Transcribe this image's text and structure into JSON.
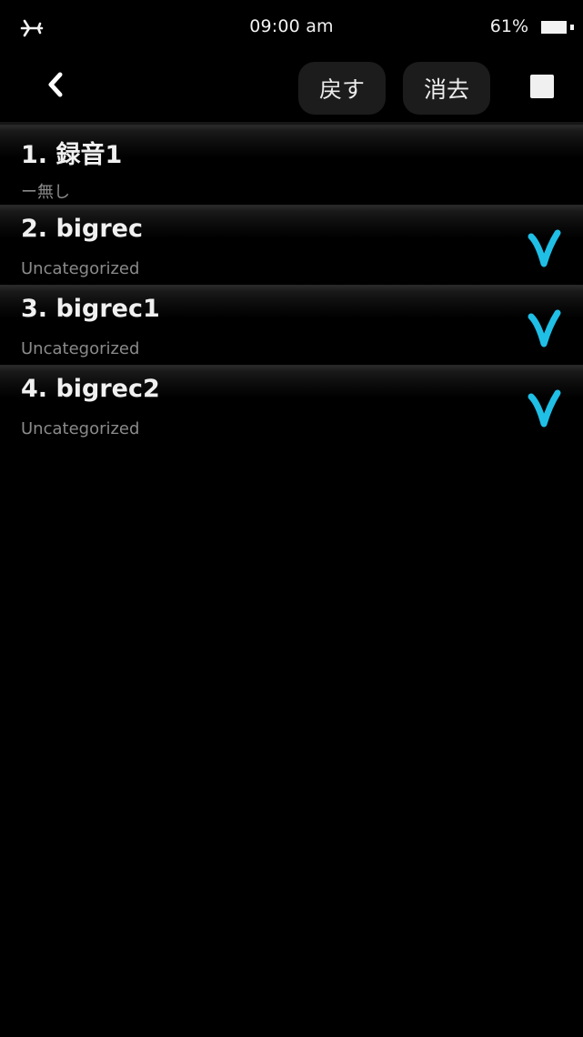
{
  "status_bar": {
    "time": "09:00 am",
    "battery_percent": "61%",
    "airplane_icon": "airplane-icon",
    "battery_level": 0.61
  },
  "toolbar": {
    "back_icon": "chevron-left-icon",
    "undo_label": "戻す",
    "delete_label": "消去",
    "select_all_checked": true
  },
  "recordings": [
    {
      "title": "1. 録音1",
      "category": "ー無し",
      "checked": false
    },
    {
      "title": "2. bigrec",
      "category": "Uncategorized",
      "checked": true
    },
    {
      "title": "3. bigrec1",
      "category": "Uncategorized",
      "checked": true
    },
    {
      "title": "4. bigrec2",
      "category": "Uncategorized",
      "checked": true
    }
  ],
  "colors": {
    "background": "#000000",
    "check_accent": "#1fbfe6",
    "button_bg": "#1c1c1c",
    "subtitle": "#8a8a8a"
  }
}
